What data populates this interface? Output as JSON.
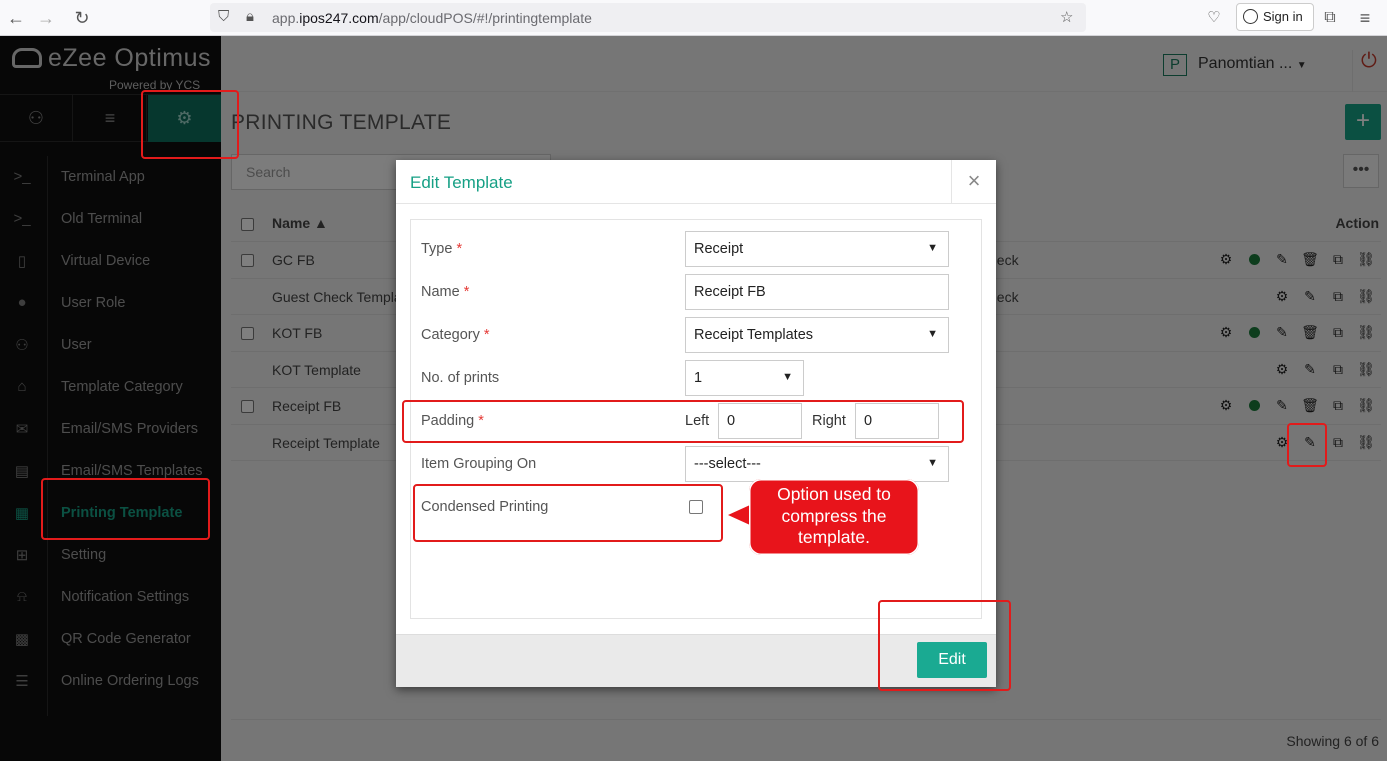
{
  "browser": {
    "url_prefix": "app.",
    "url_domain": "ipos247.com",
    "url_path": "/app/cloudPOS/#!/printingtemplate",
    "signin_label": "Sign in"
  },
  "app": {
    "brand": "eZee Optimus",
    "powered_by": "Powered by YCS",
    "user_initial": "P",
    "user_name": "Panomtian ..."
  },
  "sidebar": {
    "items": [
      {
        "label": "Terminal App",
        "icon": "terminal-icon"
      },
      {
        "label": "Old Terminal",
        "icon": "terminal-icon"
      },
      {
        "label": "Virtual Device",
        "icon": "tablet-icon"
      },
      {
        "label": "User Role",
        "icon": "user-role-icon"
      },
      {
        "label": "User",
        "icon": "user-icon"
      },
      {
        "label": "Template Category",
        "icon": "inbox-icon"
      },
      {
        "label": "Email/SMS Providers",
        "icon": "envelope-icon"
      },
      {
        "label": "Email/SMS Templates",
        "icon": "calendar-icon"
      },
      {
        "label": "Printing Template",
        "icon": "document-icon"
      },
      {
        "label": "Setting",
        "icon": "sliders-icon"
      },
      {
        "label": "Notification Settings",
        "icon": "bell-icon"
      },
      {
        "label": "QR Code Generator",
        "icon": "qr-icon"
      },
      {
        "label": "Online Ordering Logs",
        "icon": "list-icon"
      }
    ]
  },
  "page": {
    "title": "PRINTING TEMPLATE",
    "search_placeholder": "Search",
    "col_name": "Name",
    "col_action": "Action",
    "rows": [
      {
        "name": "GC FB",
        "category": "heck"
      },
      {
        "name": "Guest Check Templa",
        "category": "heck"
      },
      {
        "name": "KOT FB",
        "category": ""
      },
      {
        "name": "KOT Template",
        "category": ""
      },
      {
        "name": "Receipt FB",
        "category": ""
      },
      {
        "name": "Receipt Template",
        "category": ""
      }
    ],
    "showing": "Showing 6 of 6"
  },
  "modal": {
    "title": "Edit Template",
    "type_label": "Type",
    "type_value": "Receipt",
    "name_label": "Name",
    "name_value": "Receipt FB",
    "category_label": "Category",
    "category_value": "Receipt Templates",
    "prints_label": "No. of prints",
    "prints_value": "1",
    "padding_label": "Padding",
    "left_label": "Left",
    "left_value": "0",
    "right_label": "Right",
    "right_value": "0",
    "grouping_label": "Item Grouping On",
    "grouping_value": "---select---",
    "condensed_label": "Condensed Printing",
    "edit_button": "Edit",
    "required_mark": "*"
  },
  "annotation": {
    "callout_line1": "Option used to",
    "callout_line2": "compress the",
    "callout_line3": "template."
  }
}
